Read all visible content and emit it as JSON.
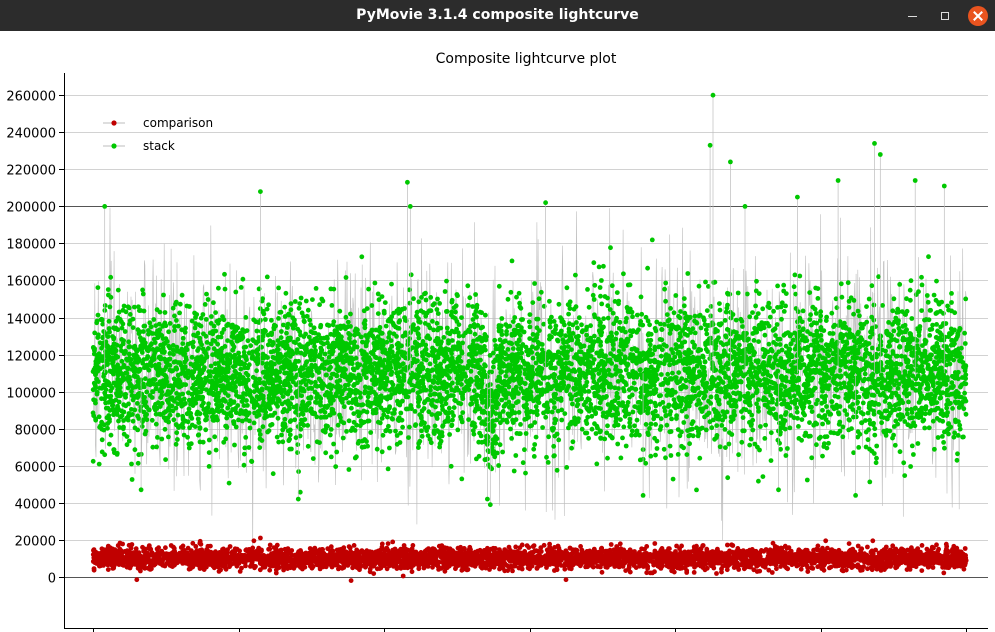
{
  "window": {
    "title": "PyMovie 3.1.4 composite lightcurve",
    "controls": [
      "minimize-icon",
      "maximize-icon",
      "close-icon"
    ]
  },
  "chart_data": {
    "type": "scatter",
    "title": "Composite lightcurve plot",
    "xlabel": "",
    "ylabel": "",
    "xlim": [
      -2000,
      61500
    ],
    "ylim": [
      -13000,
      272000
    ],
    "x_ticks": [
      0,
      10000,
      20000,
      30000,
      40000,
      50000,
      60000
    ],
    "y_ticks": [
      0,
      20000,
      40000,
      60000,
      80000,
      100000,
      120000,
      140000,
      160000,
      180000,
      200000,
      220000,
      240000,
      260000
    ],
    "grid": true,
    "legend_position": "top-left",
    "points_per_series": 60000,
    "series": [
      {
        "name": "comparison",
        "color": "#c00000",
        "x_range": [
          0,
          60000
        ],
        "center": 10000,
        "spread": [
          -2000,
          21000
        ],
        "notable_points": [
          [
            11500,
            21000
          ],
          [
            3000,
            -1500
          ],
          [
            32500,
            -1500
          ]
        ]
      },
      {
        "name": "stack",
        "color": "#00c800",
        "x_range": [
          0,
          60000
        ],
        "center": 110000,
        "spread": [
          38000,
          260000
        ],
        "notable_points": [
          [
            42600,
            260000
          ],
          [
            42400,
            233000
          ],
          [
            53700,
            234000
          ],
          [
            54100,
            228000
          ],
          [
            43800,
            224000
          ],
          [
            21600,
            213000
          ],
          [
            51200,
            214000
          ],
          [
            56500,
            214000
          ],
          [
            11500,
            208000
          ],
          [
            48400,
            205000
          ],
          [
            800,
            200000
          ],
          [
            21800,
            200000
          ],
          [
            31100,
            202000
          ],
          [
            44800,
            200000
          ],
          [
            58500,
            211000
          ],
          [
            27300,
            39000
          ],
          [
            27100,
            42000
          ],
          [
            14100,
            42000
          ],
          [
            37800,
            44000
          ],
          [
            52400,
            44000
          ],
          [
            3300,
            47000
          ],
          [
            47100,
            47000
          ]
        ],
        "low_dip": {
          "x": 27300,
          "y": 38000
        }
      }
    ]
  }
}
